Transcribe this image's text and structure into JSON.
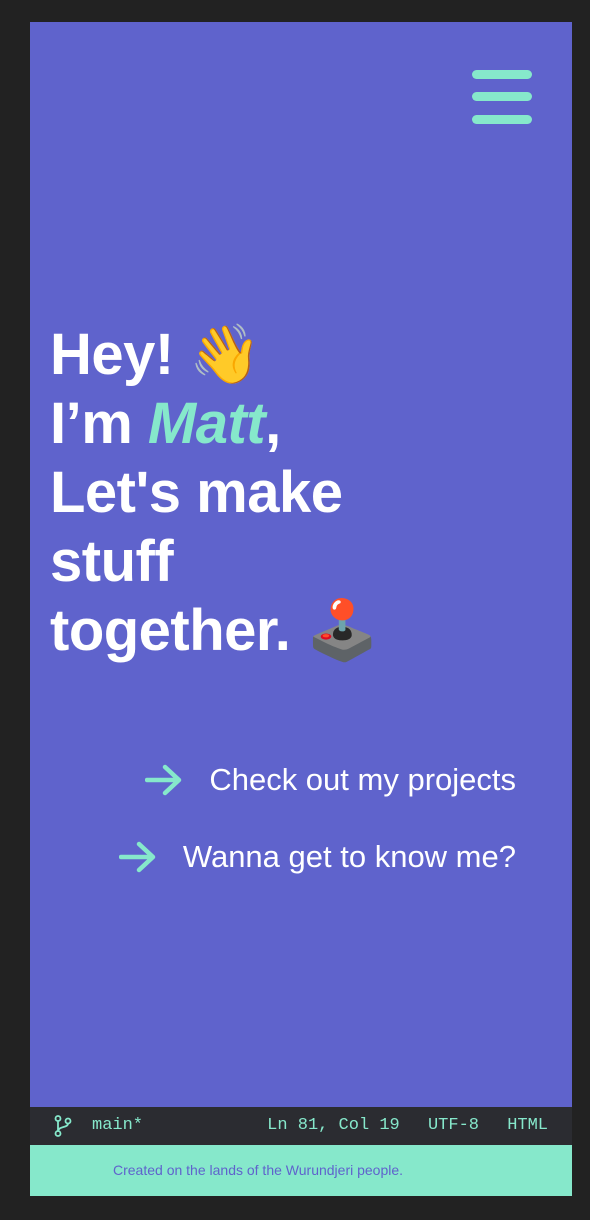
{
  "header": {
    "menu_icon": "hamburger-menu-icon"
  },
  "hero": {
    "line1_text": "Hey!",
    "line1_emoji": "👋",
    "line2_prefix": "I’m ",
    "line2_name": "Matt",
    "line2_suffix": ",",
    "line3": "Let's make",
    "line4": "stuff",
    "line5_text": "together.",
    "line5_emoji": "🕹️"
  },
  "links": [
    {
      "label": "Check out my projects",
      "icon": "arrow-right-icon"
    },
    {
      "label": "Wanna get to know me?",
      "icon": "arrow-right-icon"
    }
  ],
  "statusbar": {
    "branch_icon": "git-branch-icon",
    "branch": "main*",
    "cursor": "Ln 81, Col 19",
    "encoding": "UTF-8",
    "language": "HTML"
  },
  "footer": {
    "text": "Created on the lands of the Wurundjeri people."
  },
  "colors": {
    "background": "#5f63cc",
    "accent": "#86e8cb",
    "statusbar": "#2b2c31",
    "page": "#222222"
  }
}
